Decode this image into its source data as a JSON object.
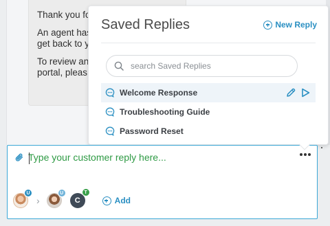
{
  "conversation": {
    "message_lines": [
      "Thank you fo",
      "An agent has",
      "get back to y",
      "To review an",
      "portal, pleas"
    ]
  },
  "saved_replies": {
    "title": "Saved Replies",
    "new_reply_label": "New Reply",
    "search_placeholder": "search Saved Replies",
    "items": [
      {
        "label": "Welcome Response",
        "active": true
      },
      {
        "label": "Troubleshooting Guide",
        "active": false
      },
      {
        "label": "Password Reset",
        "active": false
      }
    ],
    "icons": {
      "reply": "chat-bubble-icon",
      "edit": "pencil-icon",
      "insert": "play-arrow-icon"
    }
  },
  "composer": {
    "placeholder": "Type your customer reply here...",
    "participants": [
      {
        "kind": "photo",
        "badge": "U",
        "badge_color": "#2a8fc2"
      },
      {
        "kind": "photo",
        "badge": "U",
        "badge_color": "#6fb3d9"
      },
      {
        "kind": "initial",
        "initial": "C",
        "badge": "T",
        "badge_color": "#3aa04a"
      }
    ],
    "add_label": "Add"
  },
  "colors": {
    "accent": "#2a8fc2",
    "composer_border": "#3aa7d6",
    "placeholder_green": "#2e9a44"
  }
}
